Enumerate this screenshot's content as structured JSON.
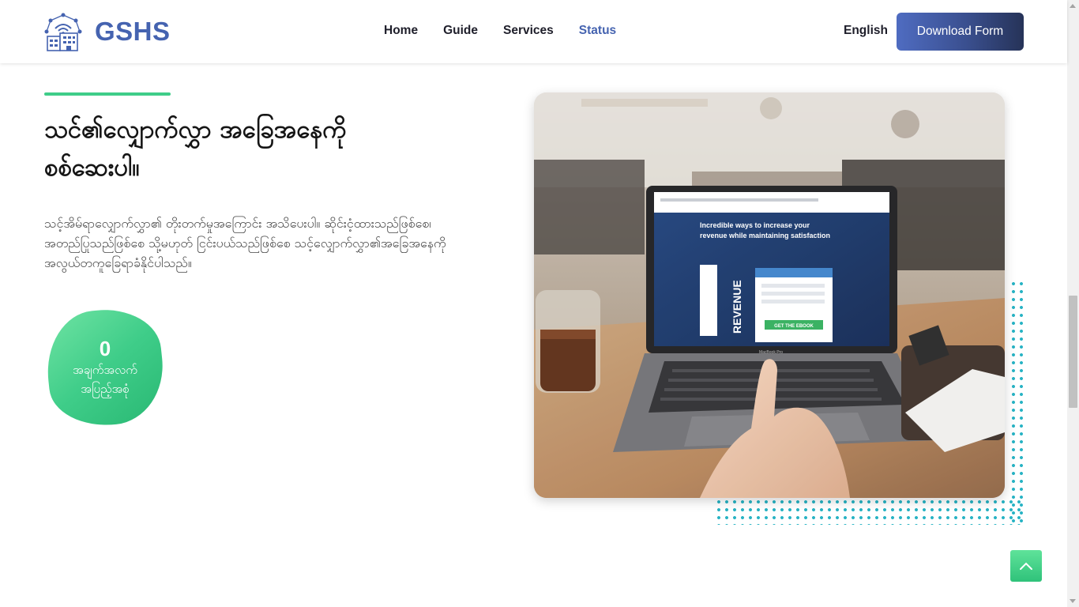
{
  "header": {
    "logo_text": "GSHS",
    "nav": {
      "home": "Home",
      "guide": "Guide",
      "services": "Services",
      "status": "Status"
    },
    "language": "English",
    "download_button": "Download Form"
  },
  "section": {
    "heading_strong": "သင်၏လျှောက်လွှာ",
    "heading_rest": " အခြေအနေကို စစ်ဆေးပါ။",
    "description": "သင့်အိမ်ရာလျှောက်လွှာ၏ တိုးတက်မှုအကြောင်း အသိပေးပါ။ ဆိုင်းငံ့ထားသည်ဖြစ်စေ၊ အတည်ပြုသည်ဖြစ်စေ သို့မဟုတ် ငြင်းပယ်သည်ဖြစ်စေ သင့်လျှောက်လွှာ၏အခြေအနေကို အလွယ်တကူခြေရာခံနိုင်ပါသည်။",
    "stat": {
      "number": "0",
      "label": "အချက်အလက် အပြည့်အစုံ"
    }
  },
  "photo": {
    "screen_headline_1": "Incredible ways to increase your",
    "screen_headline_2": "revenue while maintaining satisfaction",
    "screen_book_title": "REVENUE",
    "screen_button": "GET THE EBOOK",
    "laptop_brand": "MacBook Pro"
  },
  "colors": {
    "brand": "#4563b0",
    "accent_green": "#3fcd89",
    "dots": "#27b3c4"
  },
  "icons": {
    "logo": "building-network-icon",
    "back_to_top": "chevron-up-icon"
  }
}
